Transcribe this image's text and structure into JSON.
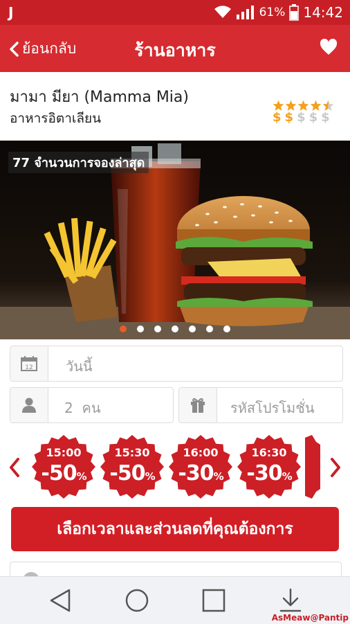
{
  "status_bar": {
    "app_glyph": "J",
    "battery": "61%",
    "time": "14:42",
    "icons": [
      "wifi-icon",
      "signal-icon",
      "battery-icon"
    ]
  },
  "app_bar": {
    "back_label": "ย้อนกลับ",
    "title": "ร้านอาหาร",
    "favorite_icon": "heart-icon"
  },
  "restaurant": {
    "name": "มามา มียา (Mamma Mia)",
    "cuisine": "อาหารอิตาเลียน",
    "rating_stars": 4.5,
    "price_level": 2,
    "price_symbols": [
      "$",
      "$",
      "$",
      "$",
      "$"
    ]
  },
  "hero": {
    "bookings_label": "77 จำนวนการจองล่าสุด",
    "slide_count": 7,
    "active_slide": 0
  },
  "form": {
    "date_value": "วันนี้",
    "date_icon": "calendar-icon",
    "people_value": "2  คน",
    "people_icon": "person-icon",
    "promo_placeholder": "รหัสโปรโมชั่น",
    "promo_icon": "gift-icon"
  },
  "deals": [
    {
      "time": "15:00",
      "discount": "-50",
      "unit": "%"
    },
    {
      "time": "15:30",
      "discount": "-50",
      "unit": "%"
    },
    {
      "time": "16:00",
      "discount": "-30",
      "unit": "%"
    },
    {
      "time": "16:30",
      "discount": "-30",
      "unit": "%"
    }
  ],
  "cta_label": "เลือกเวลาและส่วนลดที่คุณต้องการ",
  "watermark": "AsMeaw@Pantip",
  "colors": {
    "brand_red": "#d62b30",
    "deal_red": "#cc1f26",
    "star_gold": "#f2a11e"
  }
}
